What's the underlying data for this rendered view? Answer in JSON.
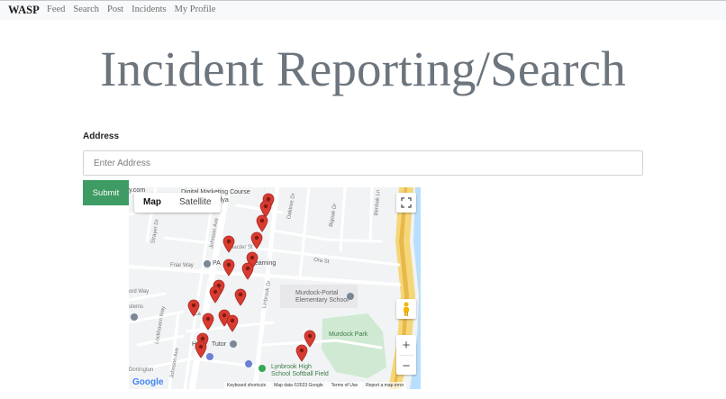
{
  "navbar": {
    "brand": "WASP",
    "links": [
      "Feed",
      "Search",
      "Post",
      "Incidents",
      "My Profile"
    ]
  },
  "page": {
    "title": "Incident Reporting/Search"
  },
  "form": {
    "address_label": "Address",
    "address_placeholder": "Enter Address",
    "address_value": "",
    "submit_label": "Submit"
  },
  "map": {
    "type_options": [
      "Map",
      "Satellite"
    ],
    "selected_type": "Map",
    "pin_color": "#d93b30",
    "park_color": "#cfe9d3",
    "water_color": "#aadaff",
    "highway_color": "#f5d77a",
    "labels": {
      "marketing": "Digital Marketing Course",
      "vidya": "Digital Vidya",
      "dotcom": "y.com",
      "pa_learning": "PA",
      "learning": "Learning",
      "stems": "stems",
      "friar_way": "Friar Way",
      "ord_way": "ord Way",
      "harder_st": "Harder St",
      "ora_st": "Ora St",
      "johnson_ave": "Johnson Ave",
      "johnson_ave2": "Johnson Ave",
      "lockhaven": "Lockhaven Way",
      "strayer": "Strayer Dr",
      "oaktree": "Oaktree Dr",
      "bigoak": "Bigoak Dr",
      "birnbak": "Birnbak Ln",
      "linbrook": "Linbrook Dr",
      "murdock_school_1": "Murdock-Portal",
      "murdock_school_2": "Elementary School",
      "murdock_park": "Murdock Park",
      "lynbrook_1": "Lynbrook High",
      "lynbrook_2": "School Softball Field",
      "hu_tutor": "Hu",
      "tutor": "Tutor",
      "donington": "Donington",
      "ca": "Ca"
    },
    "attribution": [
      "Keyboard shortcuts",
      "Map data ©2023 Google",
      "Terms of Use",
      "Report a map error"
    ],
    "google_logo": "Google",
    "zoom_in": "+",
    "zoom_out": "−"
  }
}
